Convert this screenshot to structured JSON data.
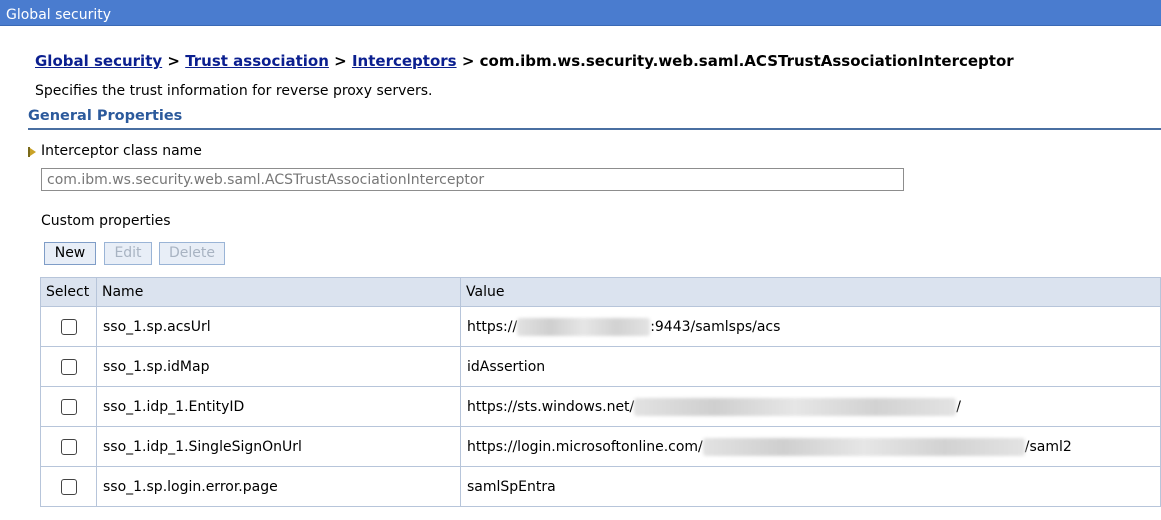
{
  "window": {
    "title": "Global security"
  },
  "breadcrumb": {
    "items": [
      "Global security",
      "Trust association",
      "Interceptors"
    ],
    "separator": ">",
    "current": "com.ibm.ws.security.web.saml.ACSTrustAssociationInterceptor"
  },
  "description": "Specifies the trust information for reverse proxy servers.",
  "section": {
    "title": "General Properties"
  },
  "interceptor": {
    "label": "Interceptor class name",
    "value": "com.ibm.ws.security.web.saml.ACSTrustAssociationInterceptor"
  },
  "custom_properties": {
    "label": "Custom properties",
    "buttons": {
      "new": "New",
      "edit": "Edit",
      "delete": "Delete"
    },
    "columns": {
      "select": "Select",
      "name": "Name",
      "value": "Value"
    },
    "rows": [
      {
        "name": "sso_1.sp.acsUrl",
        "value_prefix": "https://",
        "value_suffix": ":9443/samlsps/acs"
      },
      {
        "name": "sso_1.sp.idMap",
        "value_prefix": "idAssertion",
        "value_suffix": ""
      },
      {
        "name": "sso_1.idp_1.EntityID",
        "value_prefix": "https://sts.windows.net/",
        "value_suffix": "/"
      },
      {
        "name": "sso_1.idp_1.SingleSignOnUrl",
        "value_prefix": "https://login.microsoftonline.com/",
        "value_suffix": "/saml2"
      },
      {
        "name": "sso_1.sp.login.error.page",
        "value_prefix": "samlSpEntra",
        "value_suffix": ""
      }
    ]
  },
  "colors": {
    "titlebar": "#4a7ccf",
    "link": "#0b1f8f",
    "section": "#2c5a9c",
    "table_header": "#dbe3ef"
  }
}
